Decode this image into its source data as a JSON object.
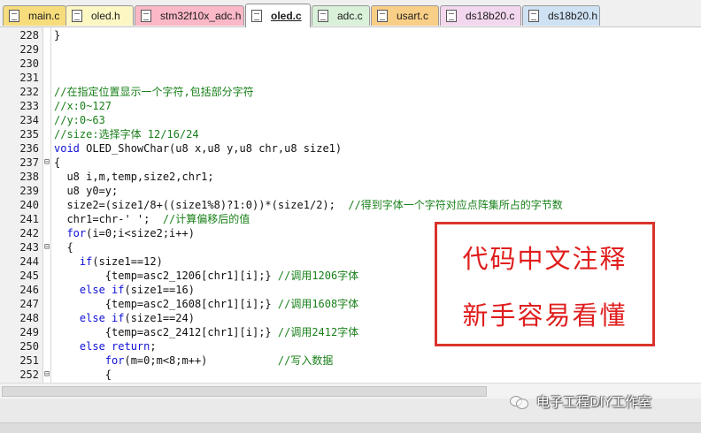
{
  "tabs": [
    {
      "label": "main.c",
      "color": "#f7dc7c",
      "active": false
    },
    {
      "label": "oled.h",
      "color": "#fdf7c4",
      "active": false
    },
    {
      "label": "stm32f10x_adc.h",
      "color": "#fbb8c6",
      "active": false
    },
    {
      "label": "oled.c",
      "color": "#cfc5ee",
      "active": true
    },
    {
      "label": "adc.c",
      "color": "#d9f1d9",
      "active": false
    },
    {
      "label": "usart.c",
      "color": "#f9ce86",
      "active": false
    },
    {
      "label": "ds18b20.c",
      "color": "#f3d7ef",
      "active": false
    },
    {
      "label": "ds18b20.h",
      "color": "#cfe2f4",
      "active": false
    }
  ],
  "editor": {
    "lines": [
      {
        "num": "228",
        "fold": "",
        "segs": [
          {
            "t": "}",
            "c": "p"
          }
        ]
      },
      {
        "num": "229",
        "fold": "",
        "segs": []
      },
      {
        "num": "230",
        "fold": "",
        "segs": []
      },
      {
        "num": "231",
        "fold": "",
        "segs": []
      },
      {
        "num": "232",
        "fold": "",
        "segs": [
          {
            "t": "//在指定位置显示一个字符,包括部分字符",
            "c": "g"
          }
        ]
      },
      {
        "num": "233",
        "fold": "",
        "segs": [
          {
            "t": "//x:0~127",
            "c": "g"
          }
        ]
      },
      {
        "num": "234",
        "fold": "",
        "segs": [
          {
            "t": "//y:0~63",
            "c": "g"
          }
        ]
      },
      {
        "num": "235",
        "fold": "",
        "segs": [
          {
            "t": "//size:选择字体 12/16/24",
            "c": "g"
          }
        ]
      },
      {
        "num": "236",
        "fold": "",
        "segs": [
          {
            "t": "void",
            "c": "b"
          },
          {
            "t": " OLED_ShowChar(u8 x,u8 y,u8 chr,u8 size1)",
            "c": "p"
          }
        ]
      },
      {
        "num": "237",
        "fold": "⊟",
        "segs": [
          {
            "t": "{",
            "c": "p"
          }
        ]
      },
      {
        "num": "238",
        "fold": "",
        "segs": [
          {
            "t": "  u8 i,m,temp,size2,chr1;",
            "c": "p"
          }
        ]
      },
      {
        "num": "239",
        "fold": "",
        "segs": [
          {
            "t": "  u8 y0=y;",
            "c": "p"
          }
        ]
      },
      {
        "num": "240",
        "fold": "",
        "segs": [
          {
            "t": "  size2=(size1/8+((size1%8)?1:0))*(size1/2);  ",
            "c": "p"
          },
          {
            "t": "//得到字体一个字符对应点阵集所占的字节数",
            "c": "g"
          }
        ]
      },
      {
        "num": "241",
        "fold": "",
        "segs": [
          {
            "t": "  chr1=chr-' ';  ",
            "c": "p"
          },
          {
            "t": "//计算偏移后的值",
            "c": "g"
          }
        ]
      },
      {
        "num": "242",
        "fold": "",
        "segs": [
          {
            "t": "  ",
            "c": "p"
          },
          {
            "t": "for",
            "c": "b"
          },
          {
            "t": "(i=0;i<size2;i++)",
            "c": "p"
          }
        ]
      },
      {
        "num": "243",
        "fold": "⊟",
        "segs": [
          {
            "t": "  {",
            "c": "p"
          }
        ]
      },
      {
        "num": "244",
        "fold": "",
        "segs": [
          {
            "t": "    ",
            "c": "p"
          },
          {
            "t": "if",
            "c": "b"
          },
          {
            "t": "(size1==12)",
            "c": "p"
          }
        ]
      },
      {
        "num": "245",
        "fold": "",
        "segs": [
          {
            "t": "        {temp=asc2_1206[chr1][i];} ",
            "c": "p"
          },
          {
            "t": "//调用1206字体",
            "c": "g"
          }
        ]
      },
      {
        "num": "246",
        "fold": "",
        "segs": [
          {
            "t": "    ",
            "c": "p"
          },
          {
            "t": "else if",
            "c": "b"
          },
          {
            "t": "(size1==16)",
            "c": "p"
          }
        ]
      },
      {
        "num": "247",
        "fold": "",
        "segs": [
          {
            "t": "        {temp=asc2_1608[chr1][i];} ",
            "c": "p"
          },
          {
            "t": "//调用1608字体",
            "c": "g"
          }
        ]
      },
      {
        "num": "248",
        "fold": "",
        "segs": [
          {
            "t": "    ",
            "c": "p"
          },
          {
            "t": "else if",
            "c": "b"
          },
          {
            "t": "(size1==24)",
            "c": "p"
          }
        ]
      },
      {
        "num": "249",
        "fold": "",
        "segs": [
          {
            "t": "        {temp=asc2_2412[chr1][i];} ",
            "c": "p"
          },
          {
            "t": "//调用2412字体",
            "c": "g"
          }
        ]
      },
      {
        "num": "250",
        "fold": "",
        "segs": [
          {
            "t": "    ",
            "c": "p"
          },
          {
            "t": "else return",
            "c": "b"
          },
          {
            "t": ";",
            "c": "p"
          }
        ]
      },
      {
        "num": "251",
        "fold": "",
        "segs": [
          {
            "t": "        ",
            "c": "p"
          },
          {
            "t": "for",
            "c": "b"
          },
          {
            "t": "(m=0;m<8;m++)           ",
            "c": "p"
          },
          {
            "t": "//写入数据",
            "c": "g"
          }
        ]
      },
      {
        "num": "252",
        "fold": "⊟",
        "segs": [
          {
            "t": "        {",
            "c": "p"
          }
        ]
      }
    ]
  },
  "callout": {
    "line1": "代码中文注释",
    "line2": "新手容易看懂",
    "color": "#e01e1e"
  },
  "watermark": {
    "text": "电子工程DIY工作室",
    "icon": "wechat-icon"
  }
}
